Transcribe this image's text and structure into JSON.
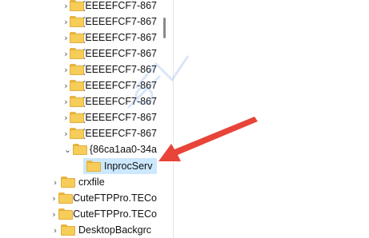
{
  "tree": {
    "rows": [
      {
        "label": "{EEEEFCF7-867",
        "expander": "collapsed"
      },
      {
        "label": "{EEEEFCF7-867",
        "expander": "collapsed"
      },
      {
        "label": "{EEEEFCF7-867",
        "expander": "collapsed"
      },
      {
        "label": "{EEEEFCF7-867",
        "expander": "collapsed"
      },
      {
        "label": "{EEEEFCF7-867",
        "expander": "collapsed"
      },
      {
        "label": "{EEEEFCF7-867",
        "expander": "collapsed"
      },
      {
        "label": "{EEEEFCF7-867",
        "expander": "collapsed"
      },
      {
        "label": "{EEEEFCF7-867",
        "expander": "collapsed"
      },
      {
        "label": "{EEEEFCF7-867",
        "expander": "collapsed"
      },
      {
        "label": "{86ca1aa0-34a",
        "expander": "expanded"
      },
      {
        "label": "InprocServ",
        "expander": "none",
        "selected": true
      },
      {
        "label": "crxfile",
        "expander": "collapsed"
      },
      {
        "label": "CuteFTPPro.TECo",
        "expander": "collapsed"
      },
      {
        "label": "CuteFTPPro.TECo",
        "expander": "collapsed"
      },
      {
        "label": "DesktopBackgrc",
        "expander": "collapsed"
      }
    ]
  },
  "colors": {
    "selection": "#cce8ff",
    "folder": "#f7cd5a",
    "arrow": "#e8443a"
  },
  "icons": {
    "collapsed": "chevron-right-icon",
    "expanded": "chevron-down-icon",
    "folder": "folder-icon"
  }
}
